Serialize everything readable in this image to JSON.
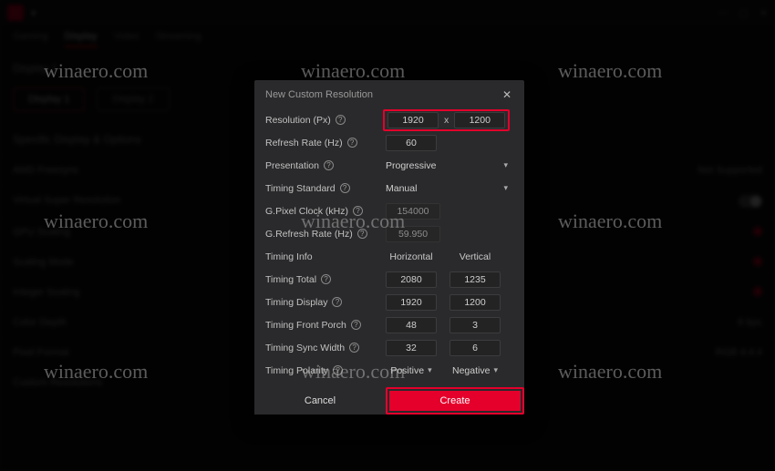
{
  "watermark": "winaero.com",
  "app": {
    "tabs": [
      "Gaming",
      "Display",
      "Video",
      "Streaming"
    ],
    "active_tab": "Display",
    "display_buttons": [
      "Display 1",
      "Display 2"
    ],
    "section_label": "Specific Display & Options"
  },
  "modal": {
    "title": "New Custom Resolution",
    "labels": {
      "resolution": "Resolution (Px)",
      "refresh": "Refresh Rate (Hz)",
      "presentation": "Presentation",
      "timing_std": "Timing Standard",
      "pixel_clock": "G.Pixel Clock (kHz)",
      "g_refresh": "G.Refresh Rate (Hz)",
      "timing_info": "Timing Info",
      "horizontal": "Horizontal",
      "vertical": "Vertical",
      "timing_total": "Timing Total",
      "timing_display": "Timing Display",
      "front_porch": "Timing Front Porch",
      "sync_width": "Timing Sync Width",
      "polarity": "Timing Polarity"
    },
    "values": {
      "res_w": "1920",
      "res_h": "1200",
      "res_sep": "x",
      "refresh": "60",
      "presentation": "Progressive",
      "timing_std": "Manual",
      "pixel_clock": "154000",
      "g_refresh": "59.950",
      "total_h": "2080",
      "total_v": "1235",
      "disp_h": "1920",
      "disp_v": "1200",
      "fp_h": "48",
      "fp_v": "3",
      "sw_h": "32",
      "sw_v": "6",
      "pol_h": "Positive",
      "pol_v": "Negative"
    },
    "buttons": {
      "cancel": "Cancel",
      "create": "Create"
    }
  }
}
